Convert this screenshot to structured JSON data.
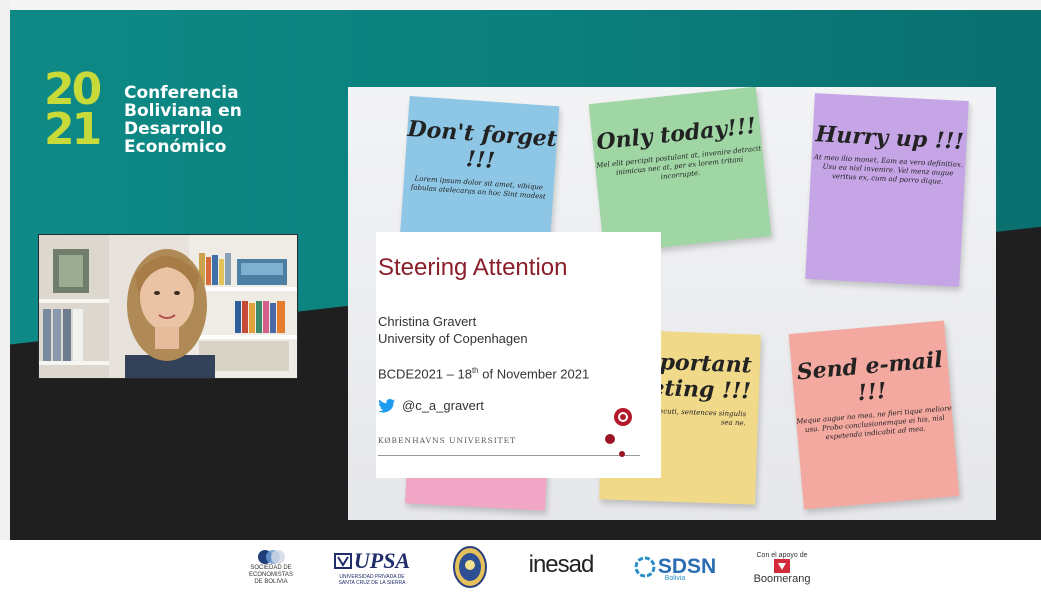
{
  "brand": {
    "year": "2021",
    "year_line1": "20",
    "year_line2": "21",
    "title_lines": [
      "Conferencia",
      "Boliviana en",
      "Desarrollo",
      "Económico"
    ]
  },
  "slide": {
    "notes": [
      {
        "heading": "Don't forget !!!",
        "body": "Lorem ipsum dolor sit amet, vibique fabulas atelecaras an hoc Sint modest",
        "color": "#8ec6e6"
      },
      {
        "heading": "Only today!!!",
        "body": "Mel elit percipit postulant at, invenire detracit inimicus nec at, per ex lorem tritani incorrupte.",
        "color": "#9fd6a4"
      },
      {
        "heading": "Hurry up !!!",
        "body": "At meo ilio monet, Eam ea vero definitiox. Usu ea nisl invenire. Vel menz augue veritus ex, cum ad porro dique.",
        "color": "#c5a5e6"
      },
      {
        "heading": "portant eting !!!",
        "body": "cancellos persecuti, sentences singulis sea ne.",
        "color": "#f1d98a"
      },
      {
        "heading": "Send e-mail !!!",
        "body": "Meque augue no mea, ne fieri tique meliore usu. Probo conclusionemque ei his, nisl expetenda indicabit ad mea.",
        "color": "#f4a9a0"
      },
      {
        "heading": "",
        "body": "",
        "color": "#f2a6c6"
      }
    ],
    "title": "Steering Attention",
    "author": "Christina Gravert",
    "affiliation": "University of Copenhagen",
    "event_prefix": "BCDE2021 – 18",
    "event_sup": "th",
    "event_suffix": " of November 2021",
    "twitter_handle": "@c_a_gravert",
    "university_wordmark": "KØBENHAVNS UNIVERSITET"
  },
  "webcam": {
    "icon": "person-video-feed"
  },
  "footer": {
    "logos": [
      {
        "name": "SOCIEDAD DE ECONOMISTAS DE BOLIVIA",
        "line1": "SOCIEDAD DE",
        "line2": "ECONOMISTAS",
        "line3": "DE BOLIVIA"
      },
      {
        "name": "UPSA",
        "mark": "UPSA",
        "sub1": "UNIVERSIDAD PRIVADA DE",
        "sub2": "SANTA CRUZ DE LA SIERRA"
      },
      {
        "name": "seal"
      },
      {
        "name": "inesad",
        "mark": "inesad"
      },
      {
        "name": "SDSN",
        "mark": "SDSN",
        "sub": "Bolivia"
      },
      {
        "name": "Boomerang",
        "prefix": "Con el apoyo de",
        "mark": "Boomerang"
      }
    ]
  },
  "colors": {
    "teal": "#0b7f7c",
    "lime": "#c8d93a",
    "dark": "#1f1f1f",
    "title_red": "#8a1f2a",
    "twitter_blue": "#1d9bf0"
  }
}
